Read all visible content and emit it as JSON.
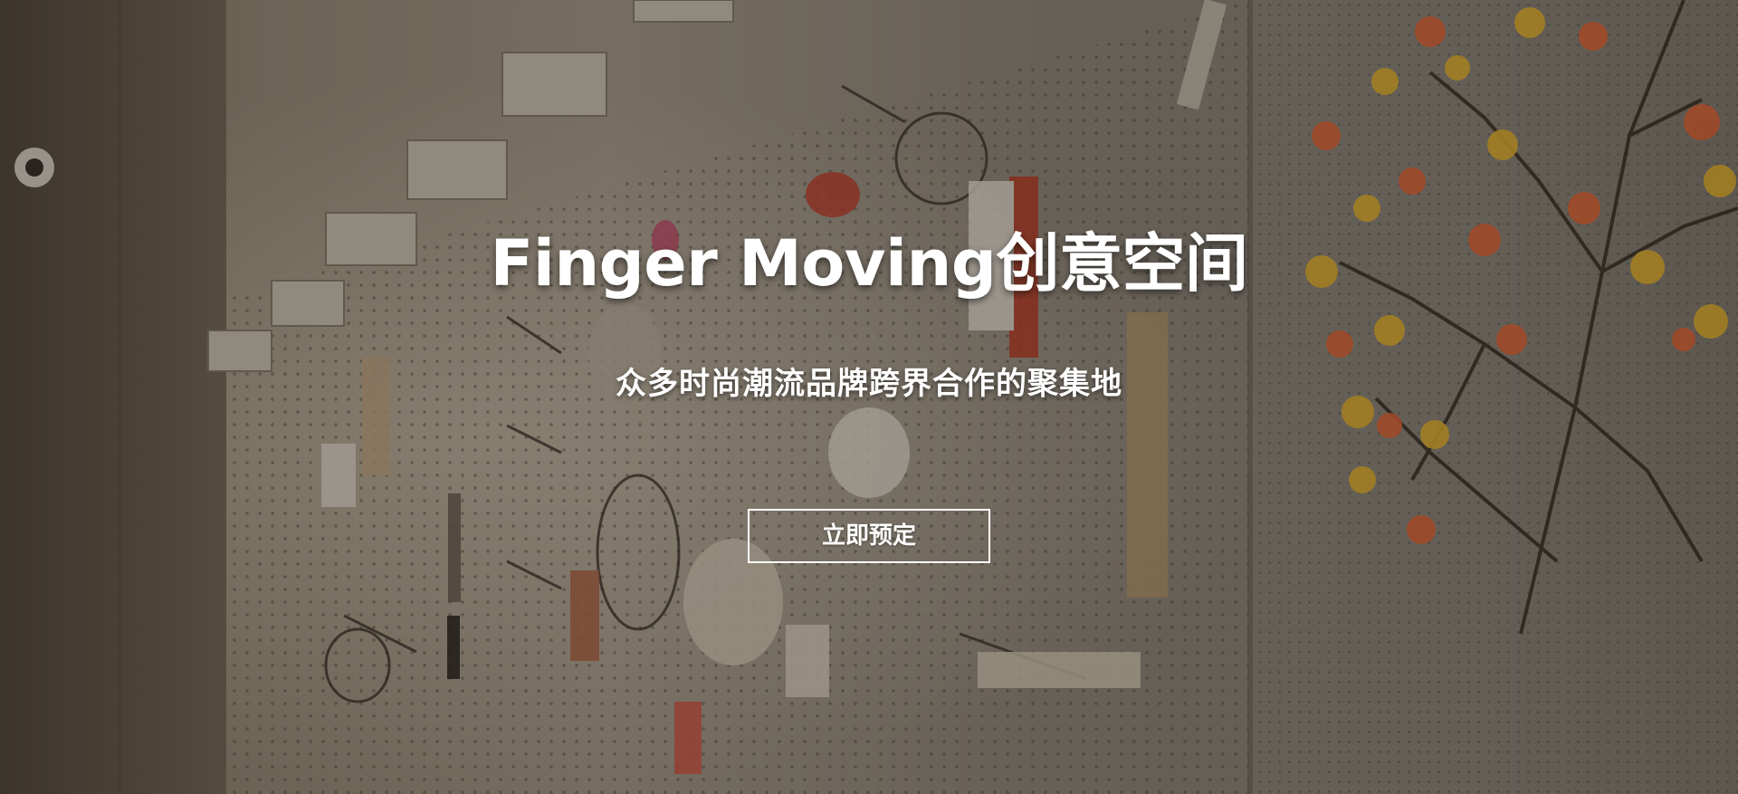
{
  "hero": {
    "title": "Finger Moving创意空间",
    "subtitle": "众多时尚潮流品牌跨界合作的聚集地",
    "cta_label": "立即预定",
    "background_image": "pegboard-wall-with-hooks-and-artwork",
    "text_color": "#ffffff"
  }
}
